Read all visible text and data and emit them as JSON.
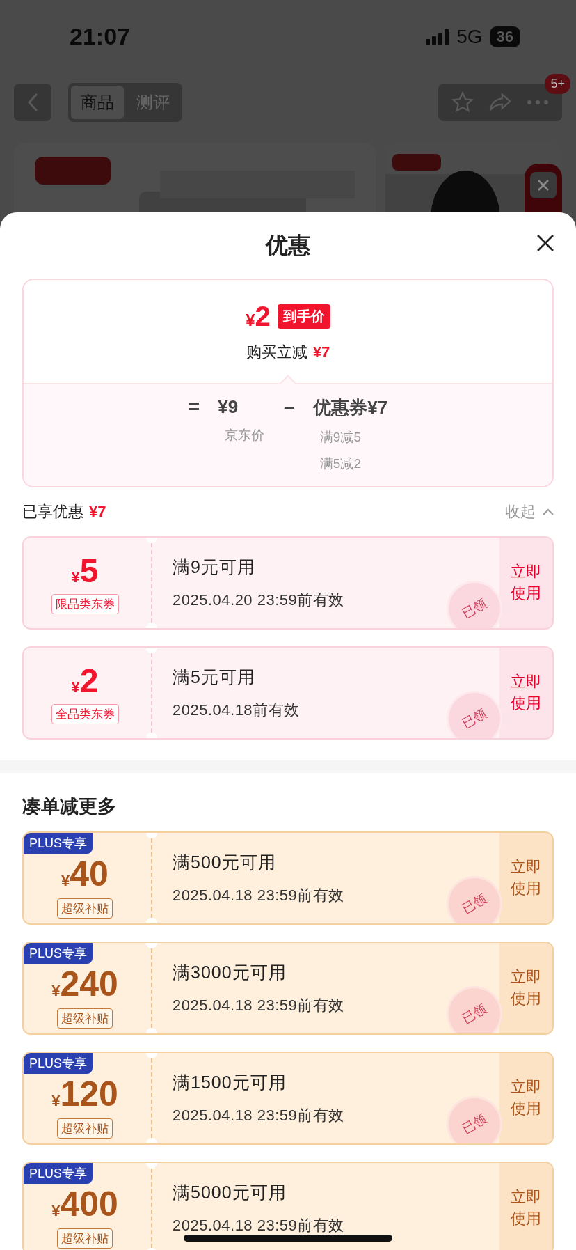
{
  "status_bar": {
    "time": "21:07",
    "network": "5G",
    "battery": "36"
  },
  "nav": {
    "tabs": [
      {
        "label": "商品",
        "selected": true
      },
      {
        "label": "测评",
        "selected": false
      }
    ],
    "badge": "5+"
  },
  "sheet": {
    "title": "优惠",
    "summary": {
      "final_currency": "¥",
      "final_amount": "2",
      "final_label": "到手价",
      "reduction_label": "购买立减",
      "reduction_amount": "¥7",
      "base_op": "=",
      "base_price": "¥9",
      "base_label": "京东价",
      "discount_op": "−",
      "discount": "优惠券¥7",
      "discount_rules": [
        "满9减5",
        "满5减2"
      ]
    },
    "enjoyed": {
      "label": "已享优惠",
      "amount": "¥7",
      "toggle": "收起",
      "expanded": true
    },
    "coupons": [
      {
        "kind": "jd",
        "currency": "¥",
        "amount": "5",
        "tag": "限品类东券",
        "condition": "满9元可用",
        "expiry": "2025.04.20 23:59前有效",
        "action": "立即使用",
        "stamp": "已领"
      },
      {
        "kind": "jd",
        "currency": "¥",
        "amount": "2",
        "tag": "全品类东券",
        "condition": "满5元可用",
        "expiry": "2025.04.18前有效",
        "action": "立即使用",
        "stamp": "已领"
      }
    ],
    "more_title": "凑单减更多",
    "more_coupons": [
      {
        "kind": "plus",
        "badge": "PLUS专享",
        "currency": "¥",
        "amount": "40",
        "tag": "超级补贴",
        "condition": "满500元可用",
        "expiry": "2025.04.18 23:59前有效",
        "action": "立即使用",
        "stamp": "已领"
      },
      {
        "kind": "plus",
        "badge": "PLUS专享",
        "currency": "¥",
        "amount": "240",
        "tag": "超级补贴",
        "condition": "满3000元可用",
        "expiry": "2025.04.18 23:59前有效",
        "action": "立即使用",
        "stamp": "已领"
      },
      {
        "kind": "plus",
        "badge": "PLUS专享",
        "currency": "¥",
        "amount": "120",
        "tag": "超级补贴",
        "condition": "满1500元可用",
        "expiry": "2025.04.18 23:59前有效",
        "action": "立即使用",
        "stamp": "已领"
      },
      {
        "kind": "plus",
        "badge": "PLUS专享",
        "currency": "¥",
        "amount": "400",
        "tag": "超级补贴",
        "condition": "满5000元可用",
        "expiry": "2025.04.18 23:59前有效",
        "action": "立即使用"
      }
    ]
  }
}
